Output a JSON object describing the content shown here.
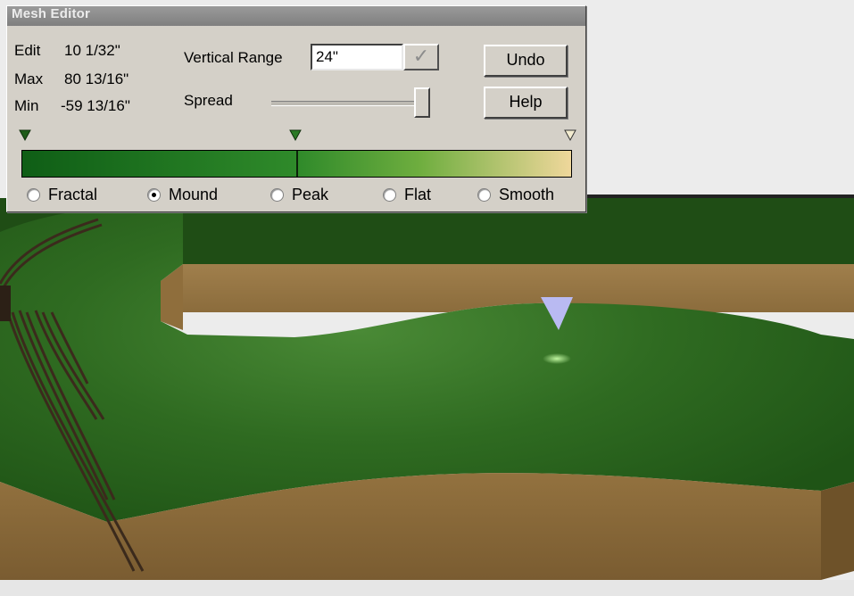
{
  "window": {
    "title": "Mesh Editor"
  },
  "info": [
    {
      "label": "Edit",
      "value": "10 1/32\""
    },
    {
      "label": "Max",
      "value": "80 13/16\""
    },
    {
      "label": "Min",
      "value": "-59 13/16\""
    }
  ],
  "vertical_range": {
    "label": "Vertical Range",
    "value": "24\"",
    "confirm_icon": "checkmark-icon"
  },
  "spread": {
    "label": "Spread",
    "level": 0.97
  },
  "buttons": {
    "undo": "Undo",
    "help": "Help"
  },
  "gradient": {
    "colors": [
      "#0f5e16",
      "#2f8a2a",
      "#6fae3f",
      "#efd79b"
    ],
    "split_fraction": 0.5,
    "marker_icons": [
      "filled-triangle-marker-icon",
      "filled-triangle-marker-icon",
      "hollow-triangle-marker-icon"
    ]
  },
  "modes": [
    {
      "label": "Fractal",
      "selected": false
    },
    {
      "label": "Mound",
      "selected": true
    },
    {
      "label": "Peak",
      "selected": false
    },
    {
      "label": "Flat",
      "selected": false
    },
    {
      "label": "Smooth",
      "selected": false
    }
  ],
  "scene": {
    "terrain_color": "#2f6b21",
    "dark_terrain_color": "#1f4a14",
    "side_color": "#8a6a3c",
    "cursor_color": "#b9baf2",
    "track_color": "#3b2a1c"
  }
}
